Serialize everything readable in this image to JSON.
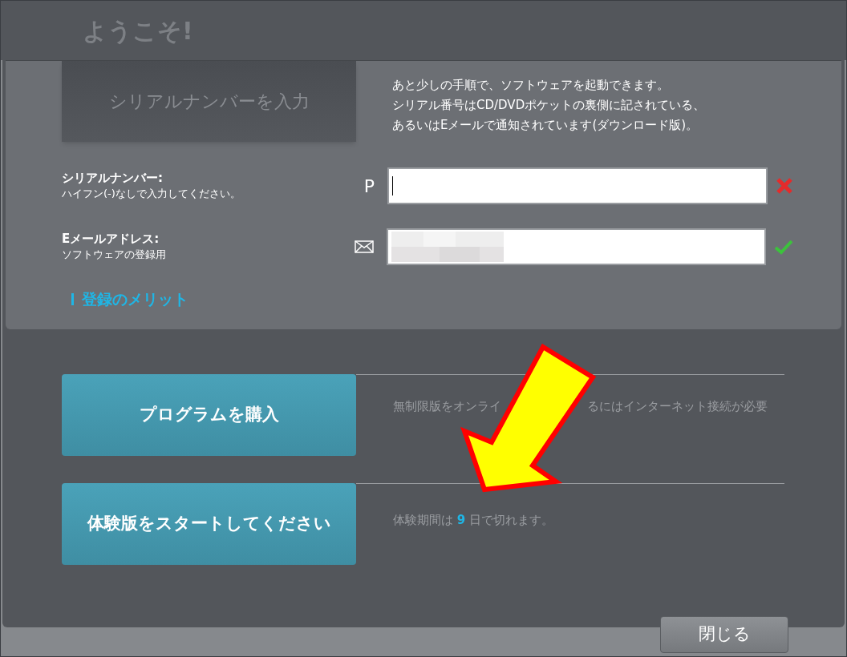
{
  "window": {
    "title": "ようこそ!"
  },
  "tabs": [
    {
      "label": "シリアルナンバーを入力",
      "selected": true
    }
  ],
  "intro": [
    "あと少しの手順で、ソフトウェアを起動できます。",
    "シリアル番号はCD/DVDポケットの裏側に記されている、",
    "あるいはEメールで通知されています(ダウンロード版)。"
  ],
  "fields": [
    {
      "label": "シリアルナンバー:",
      "hint": "ハイフン(-)なしで入力してください。",
      "prefix": "P",
      "kind": "serial",
      "valid": false
    },
    {
      "label": "Eメールアドレス:",
      "hint": "ソフトウェアの登録用",
      "kind": "email",
      "valid": true
    }
  ],
  "benefits_link": "登録のメリット",
  "actions": [
    {
      "label": "プログラムを購入",
      "note_parts": [
        "無制限版をオンライ",
        "るにはインターネット接続が必要"
      ]
    },
    {
      "label": "体験版をスタートしてください",
      "trial": {
        "prefix": "体験期間は",
        "days": "9",
        "suffix": "日で切れます。"
      }
    }
  ],
  "close_button": "閉じる"
}
